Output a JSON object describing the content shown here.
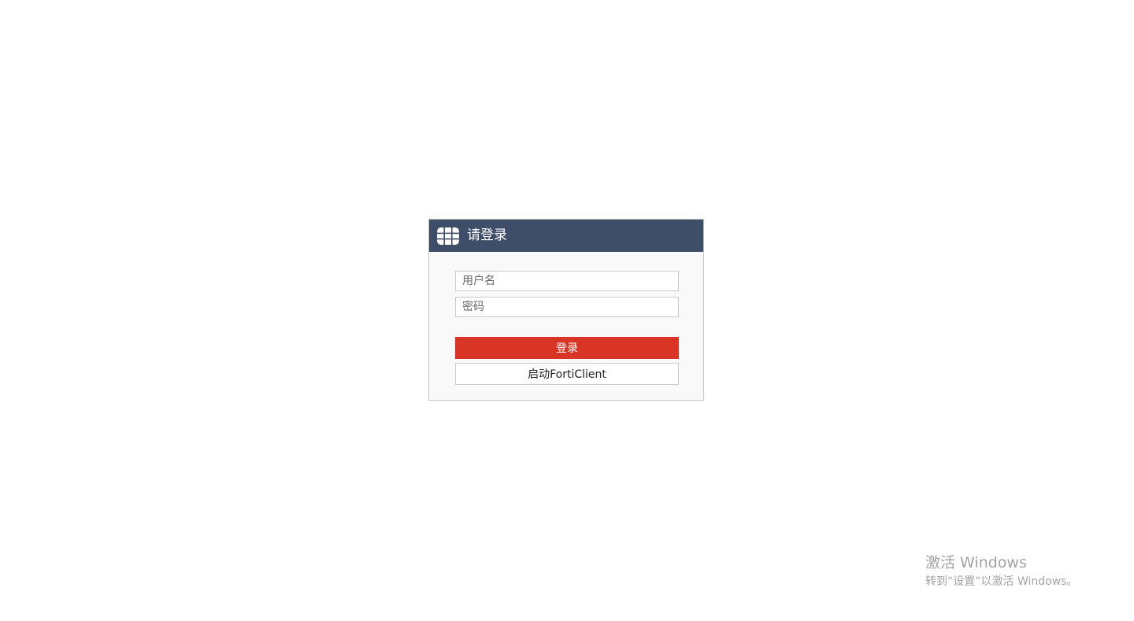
{
  "login": {
    "header_title": "请登录",
    "logo_icon": "fortinet-logo-icon",
    "username_placeholder": "用户名",
    "password_placeholder": "密码",
    "login_button": "登录",
    "forticlient_button": "启动FortiClient"
  },
  "watermark": {
    "title": "激活 Windows",
    "subtitle": "转到“设置”以激活 Windows。"
  },
  "colors": {
    "header_bg": "#3e4e69",
    "login_button_bg": "#d83526",
    "panel_bg": "#f9f9f9"
  }
}
